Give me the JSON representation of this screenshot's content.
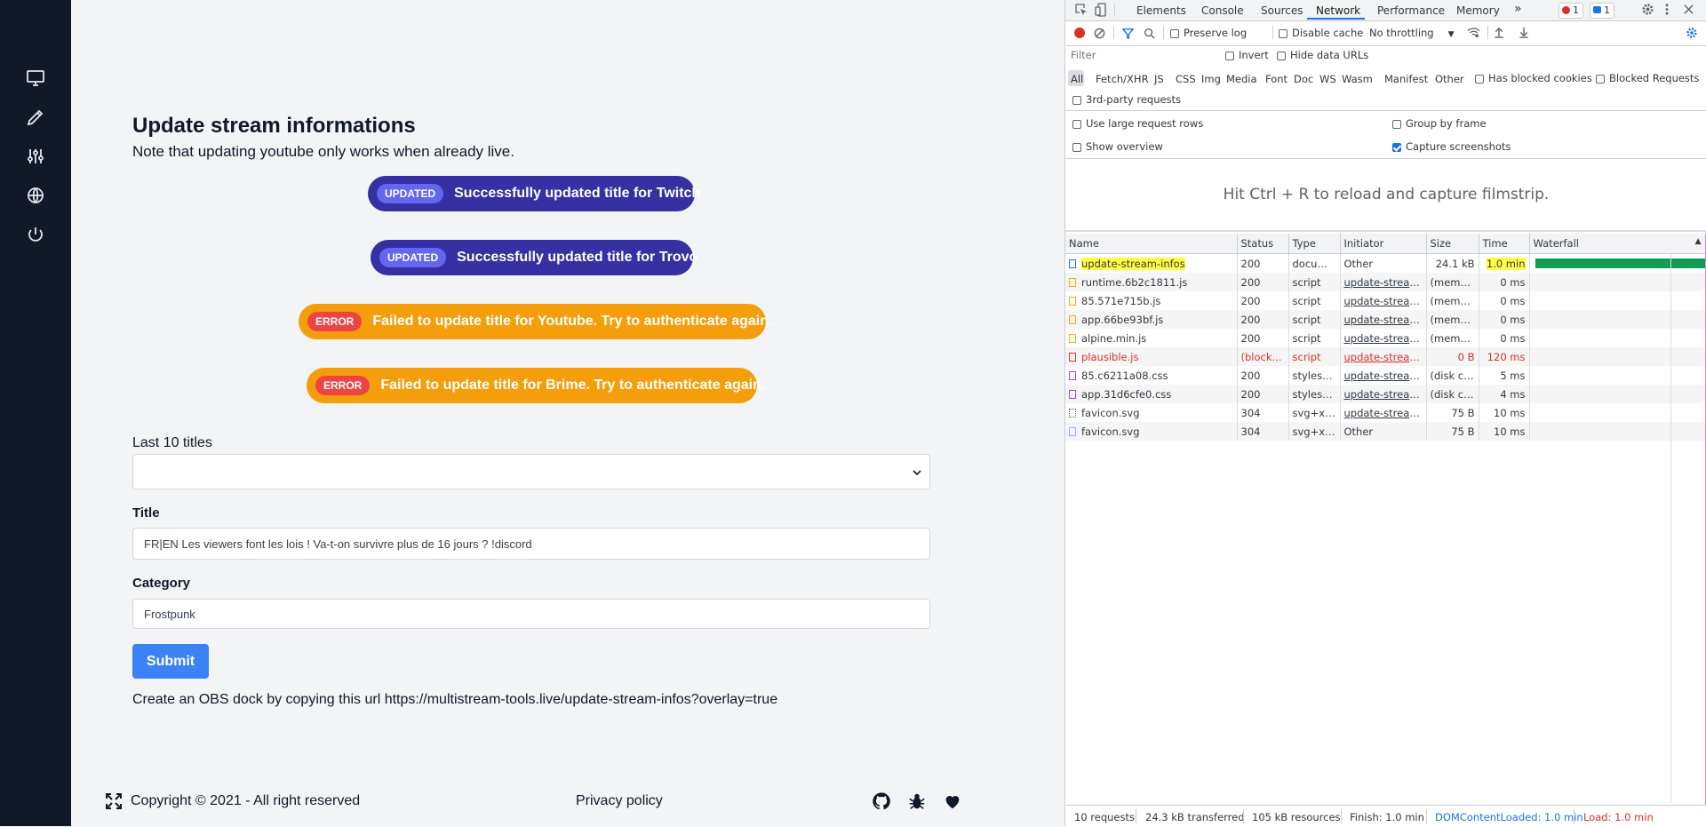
{
  "sidebar": {
    "icons": [
      "monitor-icon",
      "pen-icon",
      "sliders-icon",
      "globe-icon",
      "power-icon"
    ]
  },
  "main": {
    "title": "Update stream informations",
    "note": "Note that updating youtube only works when already live.",
    "toasts": [
      {
        "badge": "UPDATED",
        "message": "Successfully updated title for Twitch",
        "status": "success"
      },
      {
        "badge": "UPDATED",
        "message": "Successfully updated title for Trovo",
        "status": "success"
      },
      {
        "badge": "ERROR",
        "message": "Failed to update title for Youtube. Try to authenticate again.",
        "status": "error"
      },
      {
        "badge": "ERROR",
        "message": "Failed to update title for Brime. Try to authenticate again.",
        "status": "error"
      }
    ],
    "last_titles_label": "Last 10 titles",
    "last_titles_value": "",
    "title_label": "Title",
    "title_value": "FR|EN Les viewers font les lois ! Va-t-on survivre plus de 16 jours ? !discord",
    "category_label": "Category",
    "category_value": "Frostpunk",
    "submit_label": "Submit",
    "obs_text": "Create an OBS dock by copying this url https://multistream-tools.live/update-stream-infos?overlay=true"
  },
  "footer": {
    "copyright": "Copyright © 2021 - All right reserved",
    "privacy": "Privacy policy",
    "icons": [
      "github-icon",
      "bug-icon",
      "heart-icon"
    ]
  },
  "devtools": {
    "tabs": [
      "Elements",
      "Console",
      "Sources",
      "Network",
      "Performance",
      "Memory"
    ],
    "active_tab": "Network",
    "more": "»",
    "error_count": "1",
    "message_count": "1",
    "toolbar": {
      "preserve_log": "Preserve log",
      "disable_cache": "Disable cache",
      "throttling": "No throttling"
    },
    "filter": {
      "placeholder": "Filter",
      "invert": "Invert",
      "hide_data_urls": "Hide data URLs",
      "types": [
        "All",
        "Fetch/XHR",
        "JS",
        "CSS",
        "Img",
        "Media",
        "Font",
        "Doc",
        "WS",
        "Wasm",
        "Manifest",
        "Other"
      ],
      "has_blocked_cookies": "Has blocked cookies",
      "blocked_requests": "Blocked Requests",
      "third_party": "3rd-party requests"
    },
    "settings": {
      "large_rows": "Use large request rows",
      "group_by_frame": "Group by frame",
      "show_overview": "Show overview",
      "capture_screenshots": "Capture screenshots",
      "capture_checked": true
    },
    "filmstrip_hint": "Hit Ctrl + R to reload and capture filmstrip.",
    "columns": [
      "Name",
      "Status",
      "Type",
      "Initiator",
      "Size",
      "Time",
      "Waterfall"
    ],
    "requests": [
      {
        "name": "update-stream-infos",
        "status": "200",
        "type": "docum...",
        "initiator": "Other",
        "size": "24.1 kB",
        "time": "1.0 min",
        "kind": "doc"
      },
      {
        "name": "runtime.6b2c1811.js",
        "status": "200",
        "type": "script",
        "initiator": "update-stream...",
        "size": "(memo...",
        "time": "0 ms",
        "kind": "js"
      },
      {
        "name": "85.571e715b.js",
        "status": "200",
        "type": "script",
        "initiator": "update-stream...",
        "size": "(memo...",
        "time": "0 ms",
        "kind": "js"
      },
      {
        "name": "app.66be93bf.js",
        "status": "200",
        "type": "script",
        "initiator": "update-stream...",
        "size": "(memo...",
        "time": "0 ms",
        "kind": "js"
      },
      {
        "name": "alpine.min.js",
        "status": "200",
        "type": "script",
        "initiator": "update-stream...",
        "size": "(memo...",
        "time": "0 ms",
        "kind": "js"
      },
      {
        "name": "plausible.js",
        "status": "(blocke...",
        "type": "script",
        "initiator": "update-stream...",
        "size": "0 B",
        "time": "120 ms",
        "kind": "err"
      },
      {
        "name": "85.c6211a08.css",
        "status": "200",
        "type": "stylesh...",
        "initiator": "update-stream...",
        "size": "(disk ca...",
        "time": "5 ms",
        "kind": "css"
      },
      {
        "name": "app.31d6cfe0.css",
        "status": "200",
        "type": "stylesh...",
        "initiator": "update-stream...",
        "size": "(disk ca...",
        "time": "4 ms",
        "kind": "css"
      },
      {
        "name": "favicon.svg",
        "status": "304",
        "type": "svg+xml",
        "initiator": "update-stream...",
        "size": "75 B",
        "time": "10 ms",
        "kind": "svg"
      },
      {
        "name": "favicon.svg",
        "status": "304",
        "type": "svg+xml",
        "initiator": "Other",
        "size": "75 B",
        "time": "10 ms",
        "kind": "other"
      }
    ],
    "statusbar": {
      "requests": "10 requests",
      "transferred": "24.3 kB transferred",
      "resources": "105 kB resources",
      "finish": "Finish: 1.0 min",
      "dcl": "DOMContentLoaded: 1.0 min",
      "load": "Load: 1.0 min"
    },
    "colors": {
      "accent": "#1a73e8",
      "error": "#d93025",
      "waterfall": "#0f9d58",
      "highlight": "#ffff40"
    }
  }
}
